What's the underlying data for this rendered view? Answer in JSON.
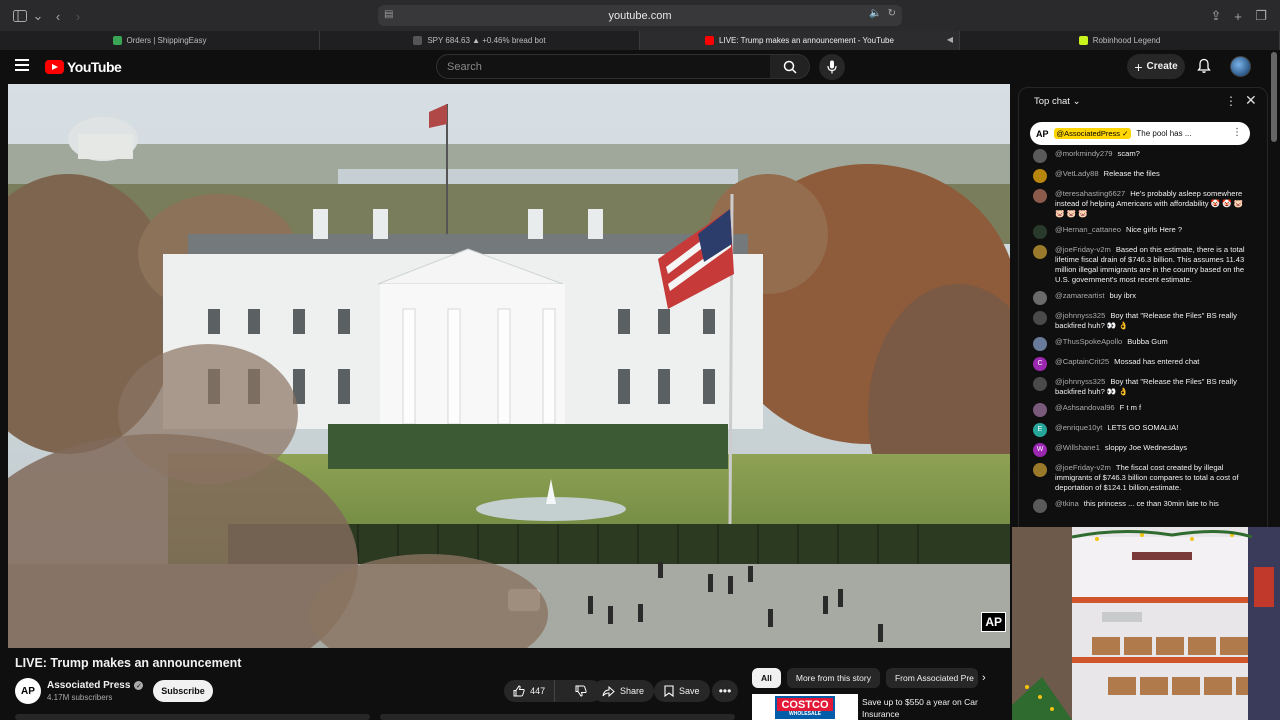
{
  "browser": {
    "url": "youtube.com",
    "tabs": [
      {
        "label": "Orders | ShippingEasy",
        "favicon_color": "#3aa655",
        "active": false
      },
      {
        "label": "SPY 684.63 ▲ +0.46% bread bot",
        "favicon_color": "#555555",
        "active": false
      },
      {
        "label": "LIVE: Trump makes an announcement - YouTube",
        "favicon_color": "#ff0000",
        "active": true
      },
      {
        "label": "Robinhood Legend",
        "favicon_color": "#c8f31d",
        "active": false
      }
    ]
  },
  "header": {
    "logo_text": "YouTube",
    "search_placeholder": "Search",
    "create_label": "Create"
  },
  "video": {
    "title": "LIVE: Trump makes an announcement",
    "watermark": "AP",
    "channel_name": "Associated Press",
    "channel_avatar_text": "AP",
    "subscribers": "4.17M subscribers",
    "subscribe_label": "Subscribe",
    "like_count": "447",
    "share_label": "Share",
    "save_label": "Save"
  },
  "chips": [
    "All",
    "More from this story",
    "From Associated Pre"
  ],
  "ad": {
    "brand": "COSTCO",
    "brand_sub": "WHOLESALE",
    "text": "Save up to $550 a year on Car Insurance"
  },
  "chat": {
    "mode": "Top chat",
    "pinned": {
      "avatar": "AP",
      "author": "@AssociatedPress ✓",
      "text": "The pool has ..."
    },
    "messages": [
      {
        "author": "@morkmindy279",
        "text": "scam?",
        "avatar_color": "#5a5a5a",
        "avatar_letter": ""
      },
      {
        "author": "@VetLady88",
        "text": "Release the files",
        "avatar_color": "#b8860b",
        "avatar_letter": ""
      },
      {
        "author": "@teresahasting6627",
        "text": "He's probably asleep somewhere instead of helping Americans with affordability 🤡 🤡 🐷 🐷 🐷 🐷",
        "avatar_color": "#8a5a4a",
        "avatar_letter": ""
      },
      {
        "author": "@Hernan_cattaneo",
        "text": "Nice girls Here ?",
        "avatar_color": "#2a3a2a",
        "avatar_letter": ""
      },
      {
        "author": "@joeFriday-v2m",
        "text": "Based on this estimate, there is a total lifetime fiscal drain of $746.3 billion. This assumes 11.43 million illegal immigrants are in the country based on the U.S. government's most recent estimate.",
        "avatar_color": "#9a7a2a",
        "avatar_letter": ""
      },
      {
        "author": "@zamareartist",
        "text": "buy ibrx",
        "avatar_color": "#6a6a6a",
        "avatar_letter": ""
      },
      {
        "author": "@johnnyss325",
        "text": "Boy that \"Release the Files\" BS really backfired huh? 👀 👌",
        "avatar_color": "#4a4a4a",
        "avatar_letter": ""
      },
      {
        "author": "@ThusSpokeApollo",
        "text": "Bubba Gum",
        "avatar_color": "#6a7a9a",
        "avatar_letter": ""
      },
      {
        "author": "@CaptainCrit25",
        "text": "Mossad has entered chat",
        "avatar_color": "#9c27b0",
        "avatar_letter": "C"
      },
      {
        "author": "@johnnyss325",
        "text": "Boy that \"Release the Files\" BS really backfired huh? 👀 👌",
        "avatar_color": "#4a4a4a",
        "avatar_letter": ""
      },
      {
        "author": "@Ashsandoval96",
        "text": "F t m f",
        "avatar_color": "#7a5a7a",
        "avatar_letter": ""
      },
      {
        "author": "@enrique10yt",
        "text": "LETS GO SOMALIA!",
        "avatar_color": "#26a69a",
        "avatar_letter": "E"
      },
      {
        "author": "@Willshane1",
        "text": "sloppy Joe Wednesdays",
        "avatar_color": "#9c27b0",
        "avatar_letter": "W"
      },
      {
        "author": "@joeFriday-v2m",
        "text": "The fiscal cost created by illegal immigrants of $746.3 billion compares to total a cost of deportation of $124.1 billion,estimate.",
        "avatar_color": "#9a7a2a",
        "avatar_letter": ""
      },
      {
        "author": "@tkina",
        "text": "this princess ... ce than 30min late to his",
        "avatar_color": "#5a5a5a",
        "avatar_letter": ""
      }
    ]
  }
}
